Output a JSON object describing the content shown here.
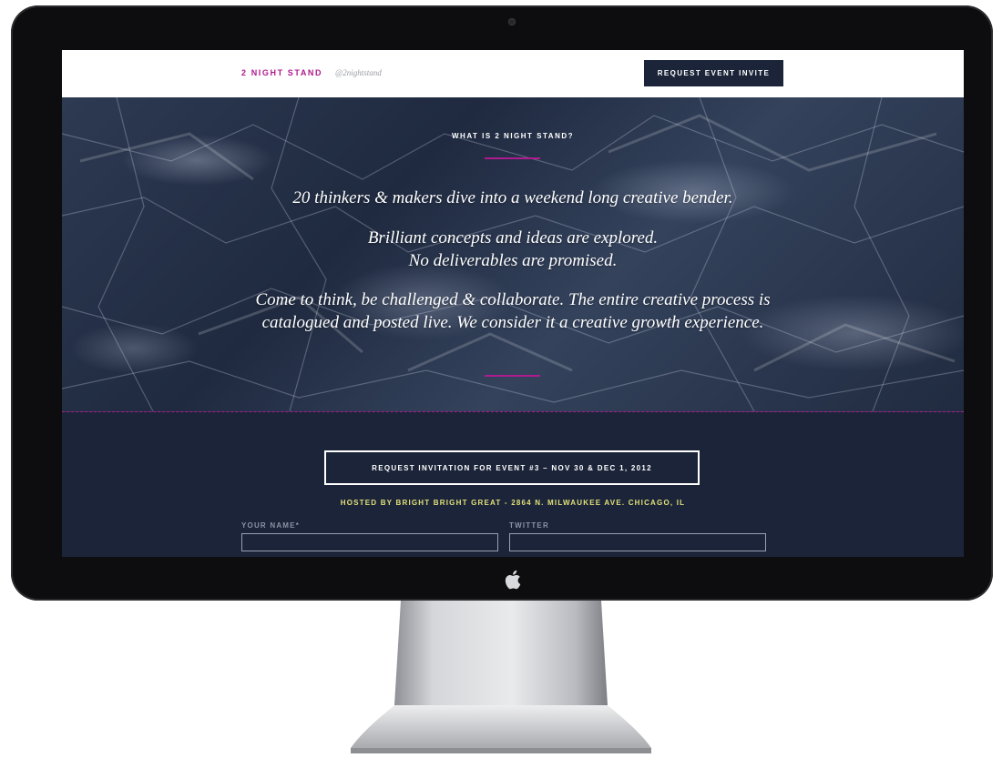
{
  "header": {
    "brand": "2 NIGHT STAND",
    "handle": "@2nightstand",
    "cta_label": "REQUEST EVENT INVITE"
  },
  "hero": {
    "eyebrow": "WHAT IS 2 NIGHT STAND?",
    "paragraph_1": "20 thinkers & makers dive into a weekend long creative bender.",
    "paragraph_2_line_1": "Brilliant concepts and ideas are explored.",
    "paragraph_2_line_2": "No deliverables are promised.",
    "paragraph_3": "Come to think, be challenged & collaborate. The entire creative process is catalogued and posted live. We consider it a creative growth experience."
  },
  "form": {
    "invite_label": "REQUEST INVITATION FOR EVENT #3 – NOV 30 & DEC 1, 2012",
    "hosted_by": "HOSTED BY BRIGHT BRIGHT GREAT - 2864 N. MILWAUKEE AVE. CHICAGO, IL",
    "name_label": "YOUR NAME*",
    "name_value": "",
    "twitter_label": "TWITTER",
    "twitter_value": ""
  },
  "colors": {
    "accent": "#b01a8f",
    "navy": "#1b2438",
    "hosted_text": "#e3e07a",
    "bezel": "#0d0d0f"
  },
  "icons": {
    "camera": "camera-icon",
    "apple": "apple-logo-icon"
  }
}
